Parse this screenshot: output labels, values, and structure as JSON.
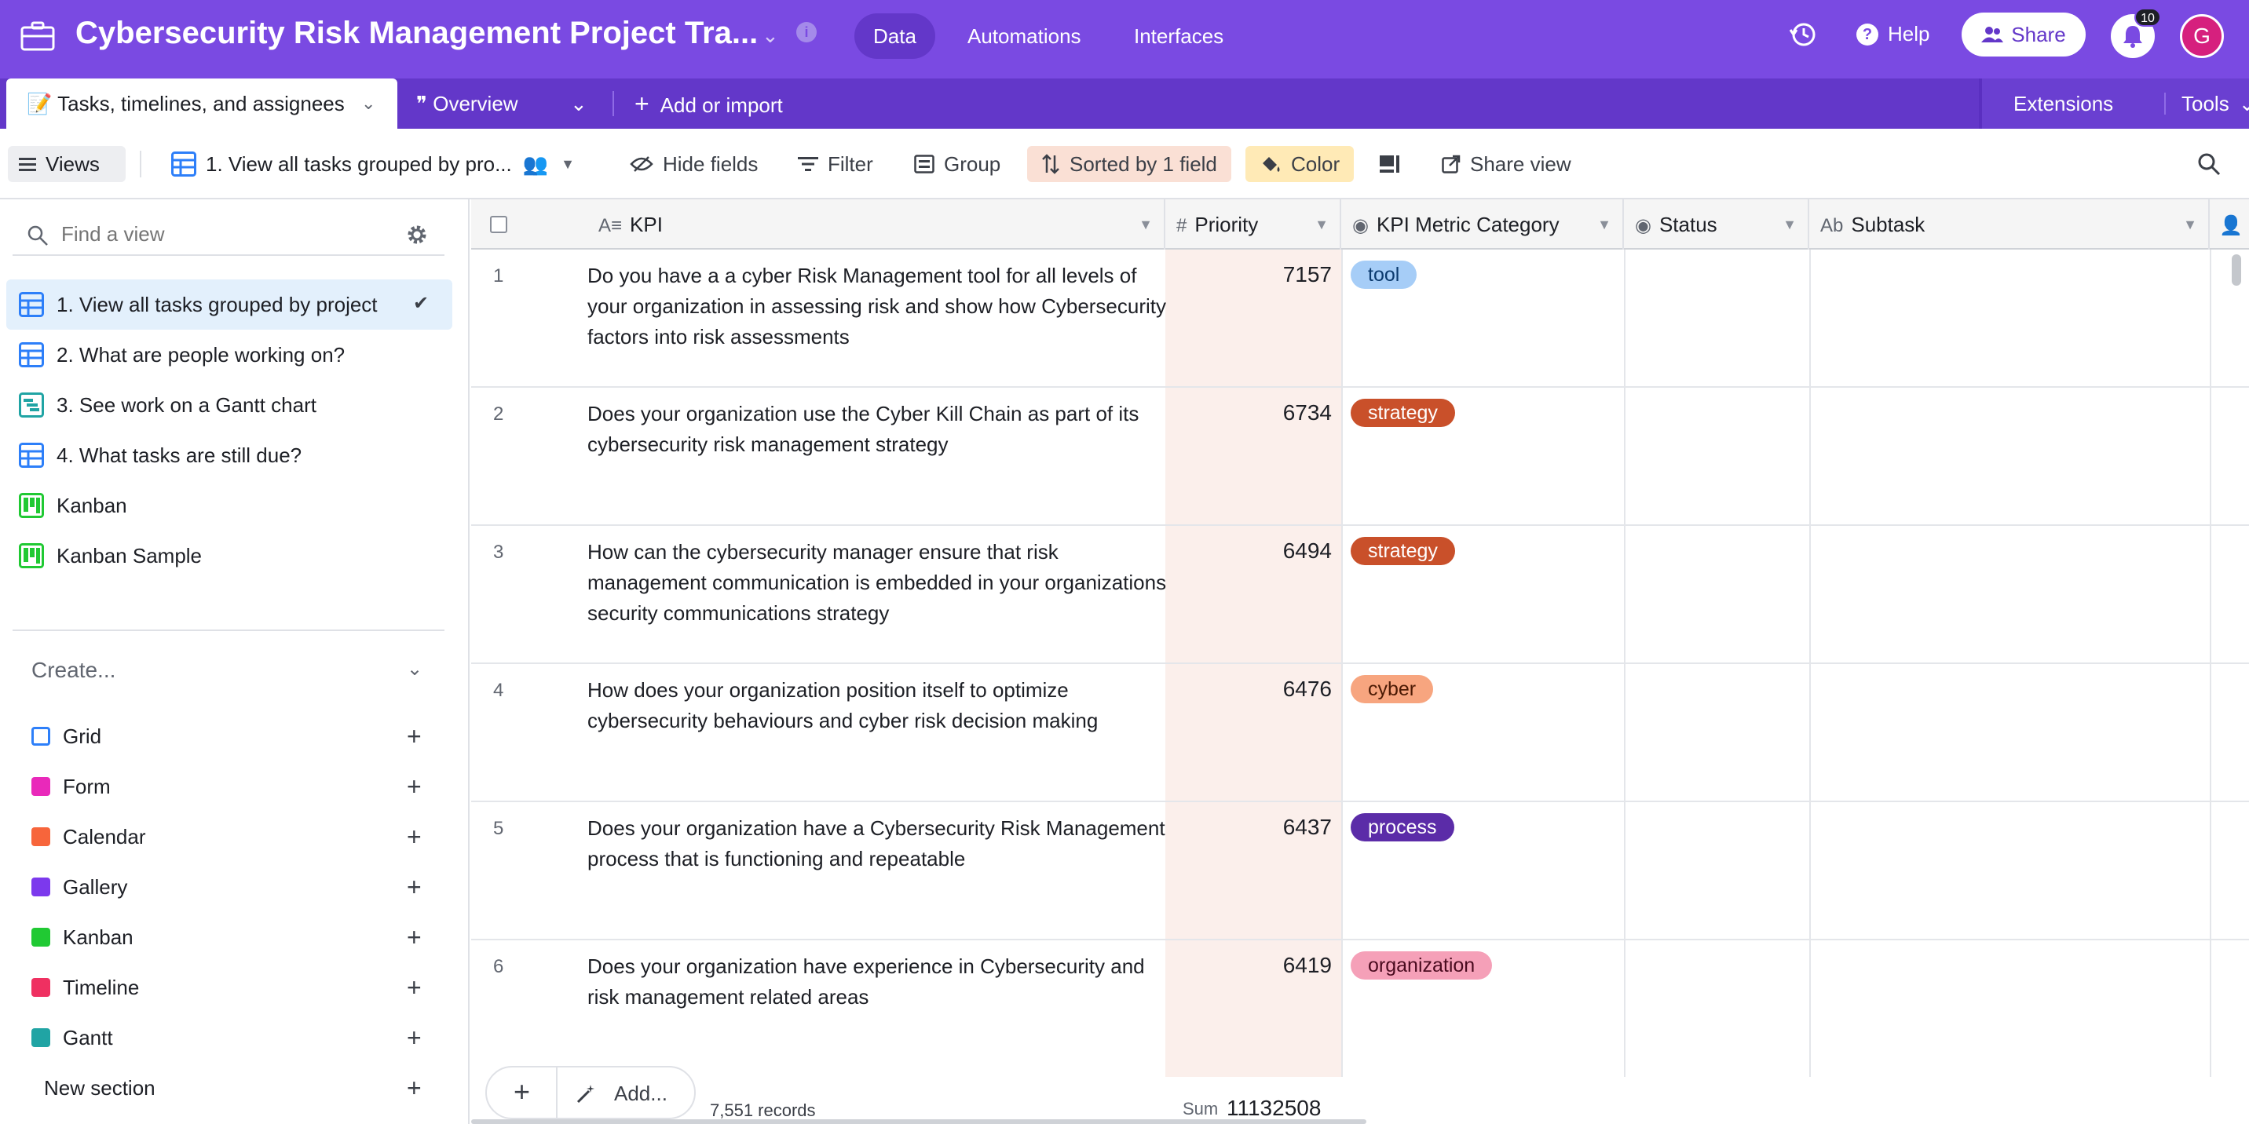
{
  "header": {
    "title": "Cybersecurity Risk Management Project Tra...",
    "nav": [
      "Data",
      "Automations",
      "Interfaces"
    ],
    "help_label": "Help",
    "share_label": "Share",
    "notifications_count": "10",
    "avatar_initial": "G"
  },
  "tabs": {
    "active_table": "Tasks, timelines, and assignees",
    "overview": "Overview",
    "add_or_import": "Add or import",
    "extensions": "Extensions",
    "tools": "Tools"
  },
  "toolbar": {
    "views": "Views",
    "current_view": "1. View all tasks grouped by pro...",
    "hide_fields": "Hide fields",
    "filter": "Filter",
    "group": "Group",
    "sorted": "Sorted by 1 field",
    "color": "Color",
    "share_view": "Share view"
  },
  "sidebar": {
    "find_placeholder": "Find a view",
    "views": [
      {
        "label": "1. View all tasks grouped by project",
        "type": "grid",
        "active": true
      },
      {
        "label": "2. What are people working on?",
        "type": "grid"
      },
      {
        "label": "3. See work on a Gantt chart",
        "type": "gantt"
      },
      {
        "label": "4. What tasks are still due?",
        "type": "grid"
      },
      {
        "label": "Kanban",
        "type": "kanban"
      },
      {
        "label": "Kanban Sample",
        "type": "kanban"
      }
    ],
    "create_label": "Create...",
    "create_items": [
      {
        "label": "Grid",
        "color": "#2d7ff9"
      },
      {
        "label": "Form",
        "color": "#e929ba"
      },
      {
        "label": "Calendar",
        "color": "#f7653b"
      },
      {
        "label": "Gallery",
        "color": "#7c39ed"
      },
      {
        "label": "Kanban",
        "color": "#20c933"
      },
      {
        "label": "Timeline",
        "color": "#ef3061"
      },
      {
        "label": "Gantt",
        "color": "#20a4a4"
      }
    ],
    "new_section": "New section"
  },
  "grid": {
    "columns": [
      "KPI",
      "Priority",
      "KPI Metric Category",
      "Status",
      "Subtask"
    ],
    "rows": [
      {
        "num": "1",
        "kpi": "Do you have a a cyber Risk Management tool for all levels of your organization in assessing risk and show how Cybersecurity factors into risk assessments",
        "priority": "7157",
        "category": "tool",
        "tag_bg": "#a6cdf7",
        "tag_fg": "#0b3a6e"
      },
      {
        "num": "2",
        "kpi": "Does your organization use the Cyber Kill Chain as part of its cybersecurity risk management strategy",
        "priority": "6734",
        "category": "strategy",
        "tag_bg": "#c9502a",
        "tag_fg": "#ffffff"
      },
      {
        "num": "3",
        "kpi": "How can the cybersecurity manager ensure that risk management communication is embedded in your organizations security communications strategy",
        "priority": "6494",
        "category": "strategy",
        "tag_bg": "#c9502a",
        "tag_fg": "#ffffff"
      },
      {
        "num": "4",
        "kpi": "How does your organization position itself to optimize cybersecurity behaviours and cyber risk decision making",
        "priority": "6476",
        "category": "cyber",
        "tag_bg": "#f7a57f",
        "tag_fg": "#4b1a04"
      },
      {
        "num": "5",
        "kpi": "Does your organization have a Cybersecurity Risk Management process that is functioning and repeatable",
        "priority": "6437",
        "category": "process",
        "tag_bg": "#5b2ca8",
        "tag_fg": "#ffffff"
      },
      {
        "num": "6",
        "kpi": "Does your organization have experience in Cybersecurity and risk management related areas",
        "priority": "6419",
        "category": "organization",
        "tag_bg": "#f5a0b8",
        "tag_fg": "#4a0b1f"
      }
    ],
    "add_label": "Add...",
    "records": "7,551 records",
    "sum_label": "Sum",
    "sum_value": "11132508"
  }
}
